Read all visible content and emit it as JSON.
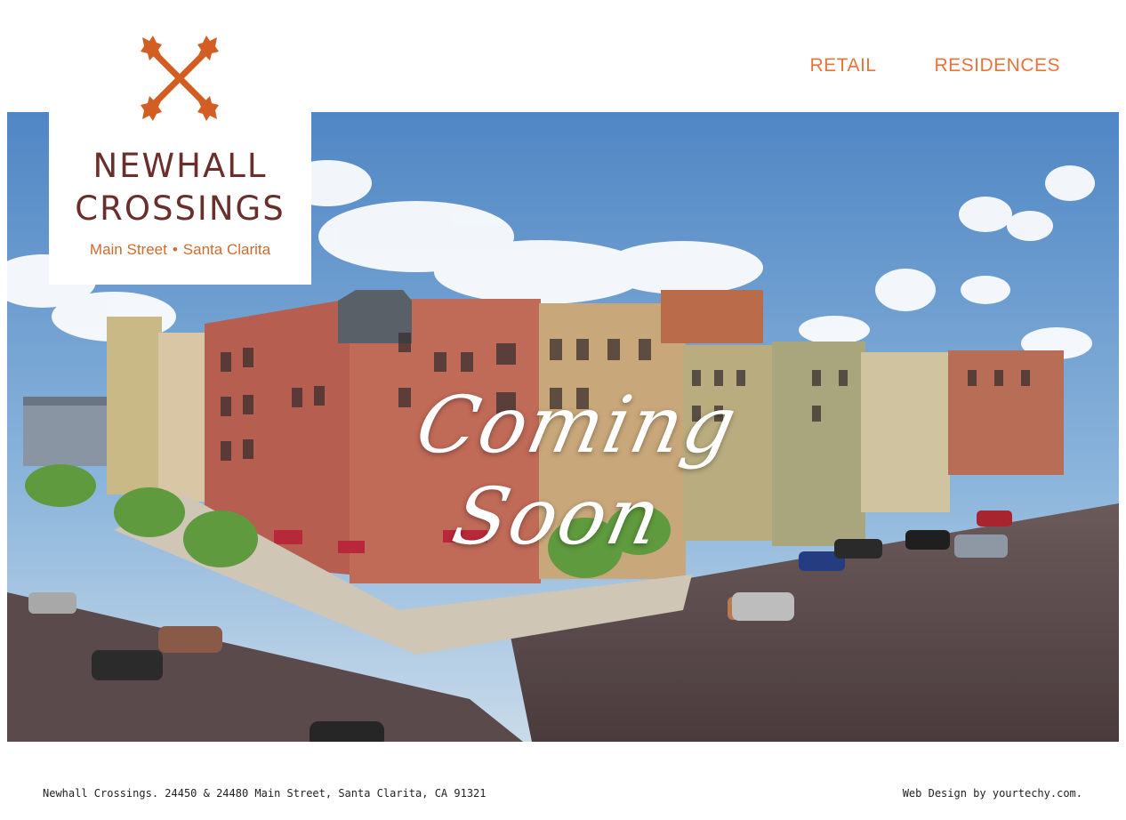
{
  "nav": {
    "items": [
      "RETAIL",
      "RESIDENCES"
    ]
  },
  "brand": {
    "line1": "NEWHALL",
    "line2": "CROSSINGS",
    "sub_street": "Main Street",
    "sub_sep": "•",
    "sub_city": "Santa Clarita",
    "colors": {
      "maroon": "#6a2e2d",
      "orange": "#cf6b2e"
    },
    "logo_icon": "crossed-oak-branches-icon"
  },
  "hero": {
    "headline": "Coming Soon"
  },
  "footer": {
    "address": "Newhall Crossings. 24450 & 24480 Main Street, Santa Clarita, CA 91321",
    "credit": "Web Design by yourtechy.com."
  },
  "colors": {
    "accent": "#e9743a"
  }
}
